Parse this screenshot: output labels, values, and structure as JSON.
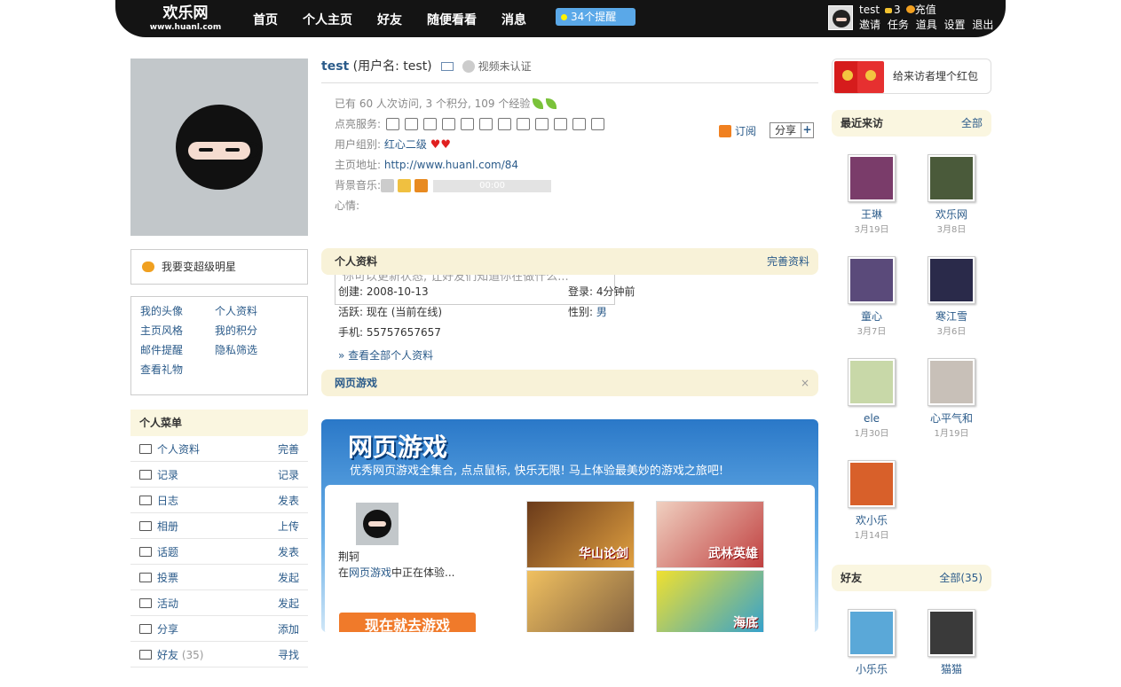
{
  "header": {
    "logo_text": "欢乐网",
    "logo_url": "www.huanl.com",
    "nav": [
      "首页",
      "个人主页",
      "好友",
      "随便看看",
      "消息"
    ],
    "remind": "34个提醒",
    "user": "test",
    "coins": "3",
    "charge": "充值",
    "links": [
      "邀请",
      "任务",
      "道具",
      "设置",
      "退出"
    ]
  },
  "left": {
    "star": "我要变超级明星",
    "links": [
      "我的头像",
      "个人资料",
      "主页风格",
      "我的积分",
      "邮件提醒",
      "隐私筛选",
      "查看礼物"
    ],
    "menu_title": "个人菜单",
    "menu": [
      {
        "label": "个人资料",
        "action": "完善"
      },
      {
        "label": "记录",
        "action": "记录"
      },
      {
        "label": "日志",
        "action": "发表"
      },
      {
        "label": "相册",
        "action": "上传"
      },
      {
        "label": "话题",
        "action": "发表"
      },
      {
        "label": "投票",
        "action": "发起"
      },
      {
        "label": "活动",
        "action": "发起"
      },
      {
        "label": "分享",
        "action": "添加"
      },
      {
        "label": "好友",
        "count": "(35)",
        "action": "寻找"
      }
    ]
  },
  "main": {
    "name": "test",
    "username": "(用户名: test)",
    "video": "视频未认证",
    "stats": "已有 60 人次访问, 3 个积分, 109 个经验",
    "services_label": "点亮服务:",
    "group_label": "用户组别:",
    "group": "红心二级",
    "homepage_label": "主页地址:",
    "homepage": "http://www.huanl.com/84",
    "music_label": "背景音乐:",
    "music_time": "00:00",
    "mood_label": "心情:",
    "subscribe": "订阅",
    "share": "分享",
    "status_placeholder": "你可以更新状态, 让好友们知道你在做什么...",
    "profile_title": "个人资料",
    "profile_action": "完善资料",
    "created_label": "创建:",
    "created": "2008-10-13",
    "login_label": "登录:",
    "login": "4分钟前",
    "active_label": "活跃:",
    "active": "现在 (当前在线)",
    "gender_label": "性别:",
    "gender": "男",
    "phone_label": "手机:",
    "phone": "55757657657",
    "see_all": "» 查看全部个人资料",
    "games_title": "网页游戏",
    "banner_title": "网页游戏",
    "banner_sub": "优秀网页游戏全集合, 点点鼠标, 快乐无限! 马上体验最美妙的游戏之旅吧!",
    "player_name": "荆轲",
    "player_desc_prefix": "在",
    "player_desc_link": "网页游戏",
    "player_desc_suffix": "中正在体验...",
    "game_button": "现在就去游戏",
    "game_titles": [
      "华山论剑",
      "武林英雄",
      "",
      "海底"
    ]
  },
  "right": {
    "redpacket": "给来访者埋个红包",
    "visitors_title": "最近来访",
    "visitors_all": "全部",
    "visitors": [
      {
        "name": "王琳",
        "date": "3月19日",
        "color": "#7a3c6a"
      },
      {
        "name": "欢乐网",
        "date": "3月8日",
        "color": "#4a5a3a"
      },
      {
        "name": "童心",
        "date": "3月7日",
        "color": "#5a4a7a"
      },
      {
        "name": "寒江雪",
        "date": "3月6日",
        "color": "#2a2a4a"
      },
      {
        "name": "ele",
        "date": "1月30日",
        "color": "#c8d8a8"
      },
      {
        "name": "心平气和",
        "date": "1月19日",
        "color": "#c8c0b8"
      },
      {
        "name": "欢小乐",
        "date": "1月14日",
        "color": "#d8602a"
      }
    ],
    "friends_title": "好友",
    "friends_all": "全部(35)",
    "friends": [
      {
        "name": "小乐乐",
        "color": "#5aa8d8"
      },
      {
        "name": "猫猫",
        "color": "#3a3a3a"
      }
    ]
  }
}
